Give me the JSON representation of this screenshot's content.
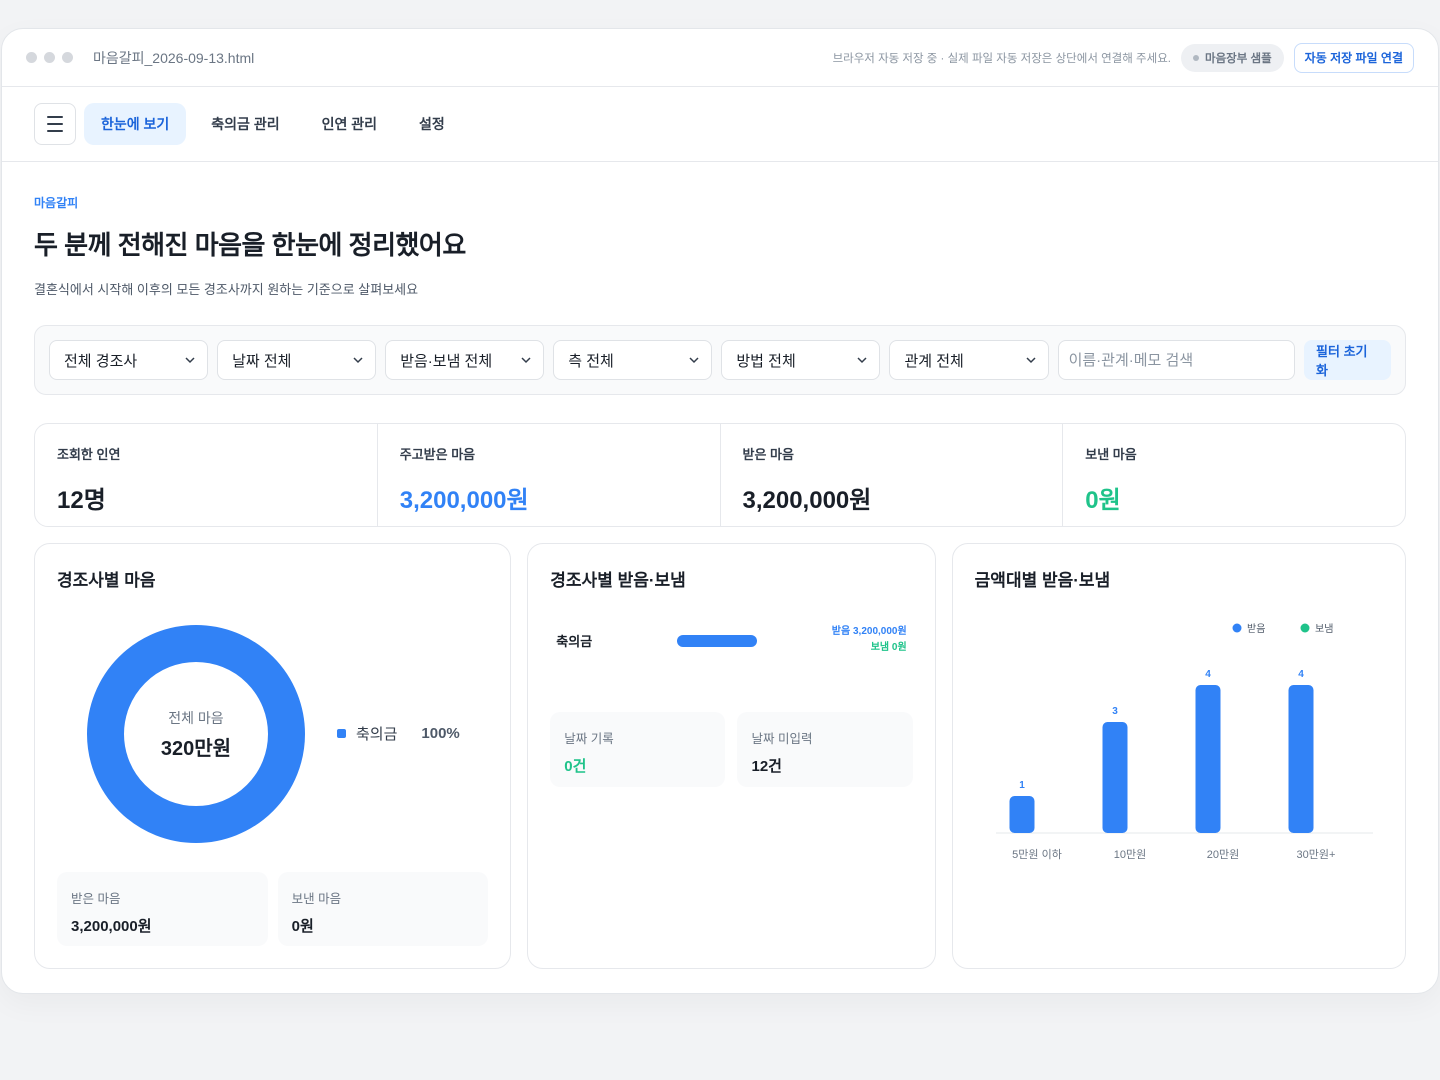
{
  "window": {
    "filename": "마음갈피_2026-09-13.html",
    "note": "브라우저 자동 저장 중 · 실제 파일 자동 저장은 상단에서 연결해 주세요.",
    "badge": "마음장부 샘플",
    "connect_button": "자동 저장 파일 연결"
  },
  "nav": {
    "tabs": [
      {
        "label": "한눈에 보기",
        "active": true
      },
      {
        "label": "축의금 관리",
        "active": false
      },
      {
        "label": "인연 관리",
        "active": false
      },
      {
        "label": "설정",
        "active": false
      }
    ]
  },
  "header": {
    "eyebrow": "마음갈피",
    "title": "두 분께 전해진 마음을 한눈에 정리했어요",
    "subtitle": "결혼식에서 시작해 이후의 모든 경조사까지 원하는 기준으로 살펴보세요"
  },
  "filters": {
    "selects": [
      "전체 경조사",
      "날짜 전체",
      "받음·보냄 전체",
      "측 전체",
      "방법 전체",
      "관계 전체"
    ],
    "search_placeholder": "이름·관계·메모 검색",
    "reset_label": "필터 초기화"
  },
  "stats": [
    {
      "label": "조회한 인연",
      "value": "12명"
    },
    {
      "label": "주고받은 마음",
      "value": "3,200,000원"
    },
    {
      "label": "받은 마음",
      "value": "3,200,000원"
    },
    {
      "label": "보낸 마음",
      "value": "0원"
    }
  ],
  "card_donut": {
    "title": "경조사별 마음",
    "center_label": "전체 마음",
    "center_value": "320만원",
    "legend": [
      {
        "name": "축의금",
        "pct": "100%",
        "color": "#3182f6"
      }
    ],
    "received_label": "받은 마음",
    "received_value": "3,200,000원",
    "sent_label": "보낸 마음",
    "sent_value": "0원"
  },
  "card_event": {
    "title": "경조사별 받음·보냄",
    "rows": [
      {
        "label": "축의금",
        "received": "받음 3,200,000원",
        "sent": "보냄 0원"
      }
    ],
    "date_recorded_label": "날짜 기록",
    "date_recorded_value": "0건",
    "date_missing_label": "날짜 미입력",
    "date_missing_value": "12건"
  },
  "card_amount": {
    "title": "금액대별 받음·보냄"
  },
  "chart_data": {
    "type": "bar",
    "categories": [
      "5만원 이하",
      "10만원",
      "20만원",
      "30만원+"
    ],
    "series": [
      {
        "name": "받음",
        "values": [
          1,
          3,
          4,
          4
        ],
        "color": "#3182f6"
      },
      {
        "name": "보냄",
        "values": [
          0,
          0,
          0,
          0
        ],
        "color": "#1fc38a"
      }
    ],
    "legend_position": "top-right",
    "data_labels": true
  }
}
